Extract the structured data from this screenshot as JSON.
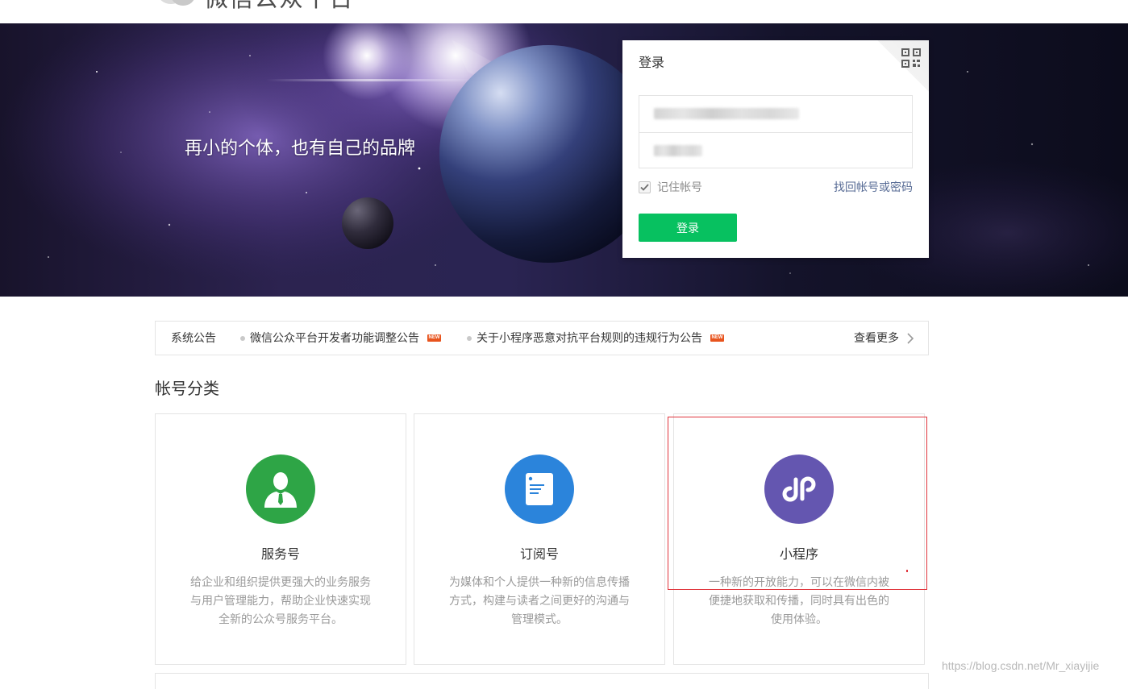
{
  "header": {
    "logo_text": "微信公众平台"
  },
  "banner": {
    "slogan": "再小的个体，也有自己的品牌"
  },
  "login": {
    "title": "登录",
    "qr_icon": "qrcode-icon",
    "remember_label": "记住帐号",
    "remember_checked": true,
    "forgot_link": "找回帐号或密码",
    "submit_label": "登录",
    "accent_color": "#07c160",
    "link_color": "#576b95"
  },
  "notice": {
    "label": "系统公告",
    "items": [
      {
        "text": "微信公众平台开发者功能调整公告",
        "badge": "NEW"
      },
      {
        "text": "关于小程序恶意对抗平台规则的违规行为公告",
        "badge": "NEW"
      }
    ],
    "more_label": "查看更多"
  },
  "categories": {
    "heading": "帐号分类",
    "cards": [
      {
        "title": "服务号",
        "icon": "service-account-icon",
        "color": "#2ea546",
        "description": [
          "给企业和组织提供更强大的业务服务",
          "与用户管理能力，帮助企业快速实现",
          "全新的公众号服务平台。"
        ]
      },
      {
        "title": "订阅号",
        "icon": "subscription-account-icon",
        "color": "#2b84db",
        "description": [
          "为媒体和个人提供一种新的信息传播",
          "方式，构建与读者之间更好的沟通与",
          "管理模式。"
        ]
      },
      {
        "title": "小程序",
        "icon": "mini-program-icon",
        "color": "#6456b0",
        "description": [
          "一种新的开放能力，可以在微信内被",
          "便捷地获取和传播，同时具有出色的",
          "使用体验。"
        ]
      }
    ]
  },
  "watermark": "https://blog.csdn.net/Mr_xiayijie"
}
